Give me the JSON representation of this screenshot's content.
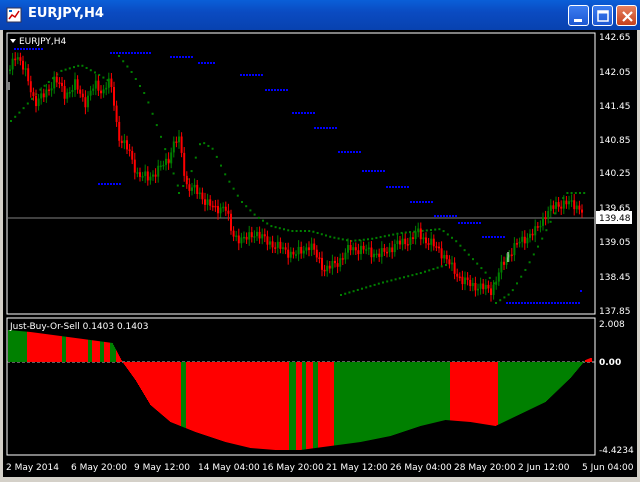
{
  "window": {
    "title": "EURJPY,H4",
    "icons": [
      "app-chart-icon",
      "minimize-icon",
      "maximize-icon",
      "close-icon"
    ]
  },
  "main_chart": {
    "label": "EURJPY,H4",
    "current_price_label": "139.48",
    "price_ticks": [
      "142.65",
      "142.05",
      "141.45",
      "140.85",
      "140.25",
      "139.65",
      "139.05",
      "138.45",
      "137.85"
    ]
  },
  "indicator": {
    "label": "Just-Buy-Or-Sell 0.1403 0.1403",
    "ticks": [
      "2.008",
      "0.00",
      "-4.4234"
    ]
  },
  "time_axis": {
    "labels": [
      "2 May 2014",
      "6 May 20:00",
      "9 May 12:00",
      "14 May 04:00",
      "16 May 20:00",
      "21 May 12:00",
      "26 May 04:00",
      "28 May 20:00",
      "2 Jun 12:00",
      "5 Jun 04:00"
    ]
  },
  "colors": {
    "background": "#000000",
    "bull_candle": "#008000",
    "bear_candle": "#ff0000",
    "trail_dots": "#008000",
    "blue_levels": "#0000ff",
    "axis_text": "#ffffff",
    "gridline": "#808080"
  }
}
